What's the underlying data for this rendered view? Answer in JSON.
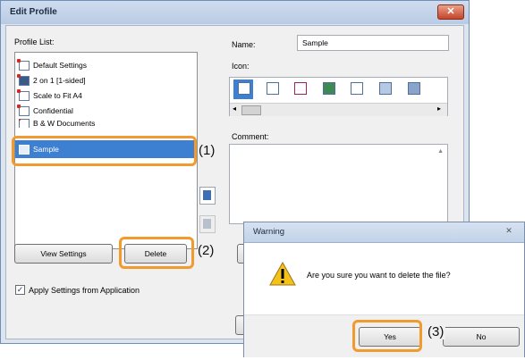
{
  "edit_profile": {
    "title": "Edit Profile",
    "close_glyph": "✕",
    "profile_list_label": "Profile List:",
    "profiles": [
      {
        "label": "Default Settings"
      },
      {
        "label": "2 on 1 [1-sided]"
      },
      {
        "label": "Scale to Fit A4"
      },
      {
        "label": "Confidential"
      },
      {
        "label": "B & W Documents"
      }
    ],
    "selected_profile": "Sample",
    "name_label": "Name:",
    "name_value": "Sample",
    "icon_label": "Icon:",
    "comment_label": "Comment:",
    "view_settings_button": "View Settings",
    "delete_button": "Delete",
    "apply_checkbox_label": "Apply Settings from Application",
    "apply_checked": true
  },
  "callouts": {
    "step1": "(1)",
    "step2": "(2)",
    "step3": "(3)"
  },
  "warning_dialog": {
    "title": "Warning",
    "close_glyph": "✕",
    "message": "Are you sure you want to delete the file?",
    "yes_button": "Yes",
    "no_button": "No"
  },
  "colors": {
    "callout_orange": "#f29a2e",
    "selection_blue": "#3d7fd0"
  }
}
